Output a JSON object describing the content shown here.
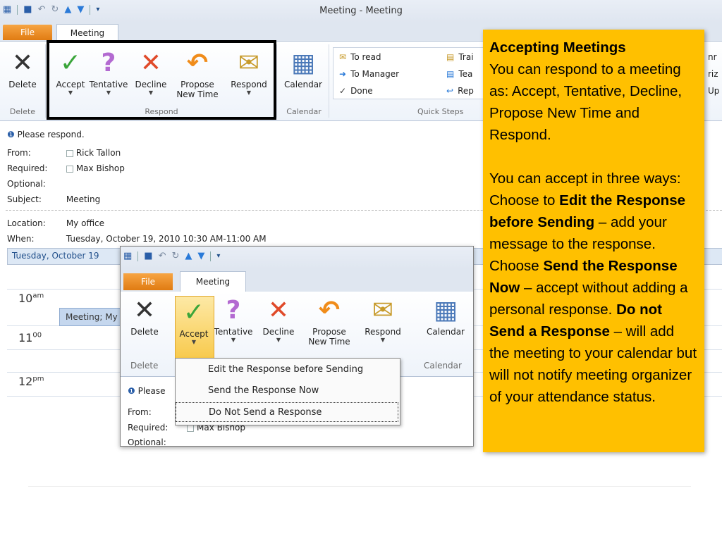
{
  "window": {
    "title": "Meeting - Meeting",
    "tabs": {
      "file": "File",
      "meeting": "Meeting"
    }
  },
  "ribbon": {
    "delete_label": "Delete",
    "accept_label": "Accept",
    "tentative_label": "Tentative",
    "decline_label": "Decline",
    "propose_label_line1": "Propose",
    "propose_label_line2": "New Time",
    "respond_label": "Respond",
    "calendar_label": "Calendar",
    "groups": {
      "delete": "Delete",
      "respond": "Respond",
      "calendar": "Calendar",
      "quick_steps": "Quick Steps"
    },
    "quick_steps": [
      {
        "label": "To read",
        "icon": "envelope-icon"
      },
      {
        "label": "To Manager",
        "icon": "forward-envelope-icon"
      },
      {
        "label": "Done",
        "icon": "checkmark-icon"
      },
      {
        "label": "Trai",
        "icon": "team-icon"
      },
      {
        "label": "Tea",
        "icon": "team-email-icon"
      },
      {
        "label": "Rep",
        "icon": "reply-icon"
      }
    ],
    "partial_right": [
      "nr",
      "riz",
      "Up"
    ]
  },
  "message": {
    "notice": "Please respond.",
    "from_label": "From:",
    "from_value": "Rick Tallon",
    "required_label": "Required:",
    "required_value": "Max Bishop",
    "optional_label": "Optional:",
    "subject_label": "Subject:",
    "subject_value": "Meeting",
    "location_label": "Location:",
    "location_value": "My office",
    "when_label": "When:",
    "when_value": "Tuesday, October 19, 2010 10:30 AM-11:00 AM"
  },
  "calendar": {
    "day_header": "Tuesday, October 19",
    "times": [
      {
        "hour": "10",
        "suffix": "am"
      },
      {
        "hour": "11",
        "suffix": "00"
      },
      {
        "hour": "12",
        "suffix": "pm"
      }
    ],
    "meeting_bar": "Meeting; My"
  },
  "inset": {
    "tabs": {
      "file": "File",
      "meeting": "Meeting"
    },
    "delete_label": "Delete",
    "accept_label": "Accept",
    "tentative_label": "Tentative",
    "decline_label": "Decline",
    "propose_label_line1": "Propose",
    "propose_label_line2": "New Time",
    "respond_label": "Respond",
    "calendar_label": "Calendar",
    "group_delete": "Delete",
    "group_calendar": "Calendar",
    "notice": "Please",
    "from_label": "From:",
    "required_label": "Required:",
    "required_value": "Max Bishop",
    "optional_label": "Optional:",
    "accept_menu": [
      {
        "label": "Edit the Response before Sending",
        "accel": "E"
      },
      {
        "label": "Send the Response Now",
        "accel": "S"
      },
      {
        "label": "Do Not Send a Response",
        "accel": "D"
      }
    ]
  },
  "callout": {
    "title": "Accepting Meetings",
    "para1": "You can respond to a meeting as: Accept, Tentative, Decline, Propose New Time and Respond.",
    "p2_a": "You can accept in three ways: Choose to ",
    "p2_b": "Edit the Response before Sending",
    "p2_c": " – add your message to the response. Choose ",
    "p2_d": "Send the Response Now",
    "p2_e": " – accept without adding a personal response. ",
    "p2_f": "Do not Send a Response",
    "p2_g": " – will add the meeting to your calendar but will not notify meeting organizer of your attendance status."
  },
  "colors": {
    "callout_bg": "#ffc000",
    "file_tab": "#e07b12",
    "accept_green": "#3aa53a",
    "tentative_purple": "#b36ad1",
    "decline_red": "#e04a2a",
    "propose_orange": "#f08c1a"
  }
}
